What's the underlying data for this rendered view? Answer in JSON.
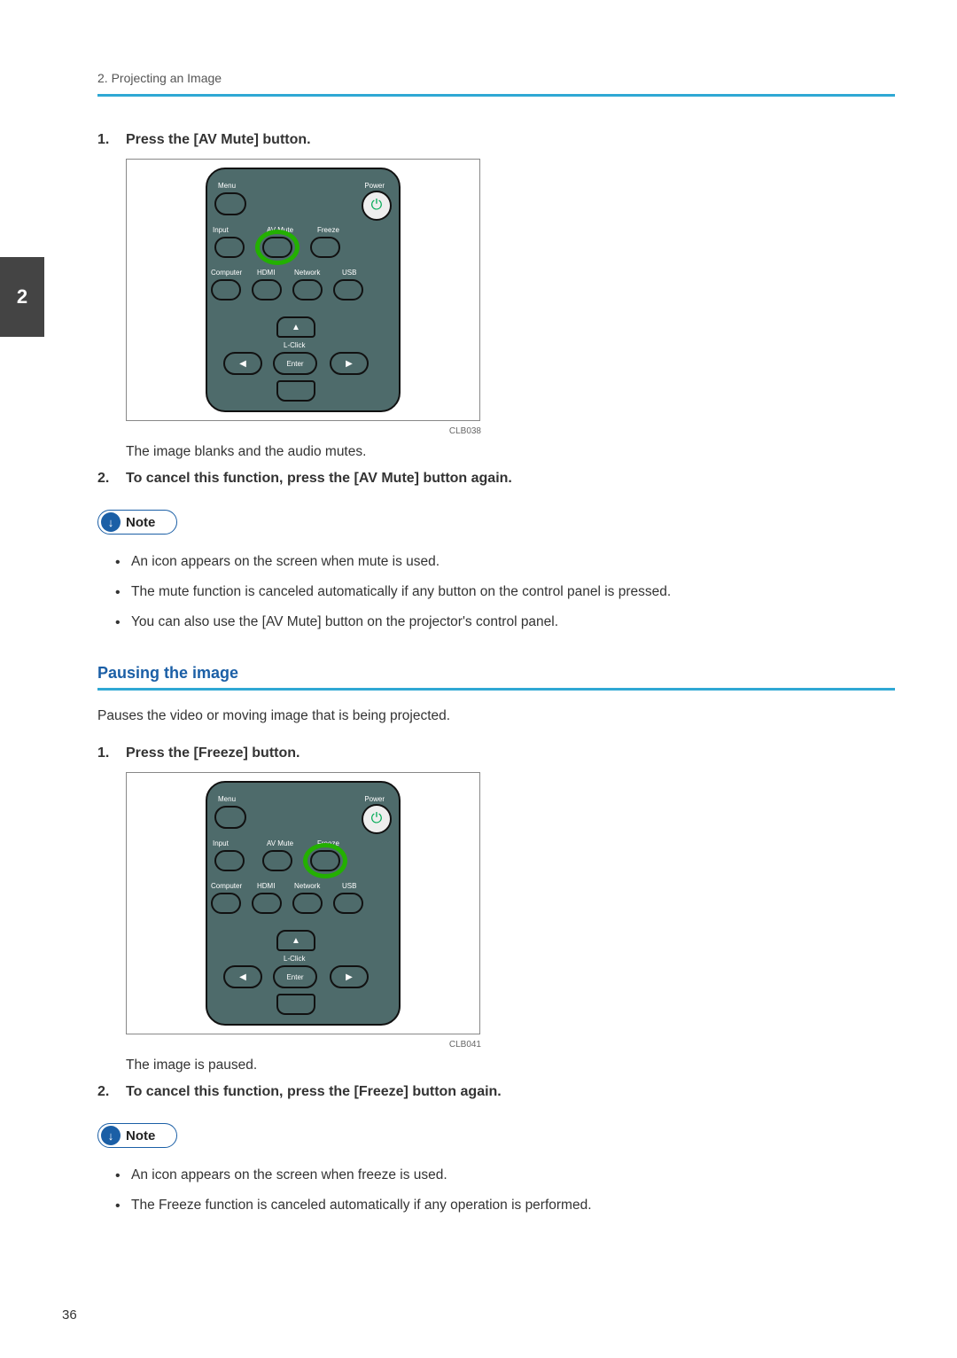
{
  "header": {
    "breadcrumb": "2. Projecting an Image"
  },
  "chapter_tab": "2",
  "section1": {
    "step1": {
      "num": "1.",
      "text": "Press the [AV Mute] button."
    },
    "remote": {
      "menu": "Menu",
      "power": "Power",
      "input": "Input",
      "avmute": "AV Mute",
      "freeze": "Freeze",
      "computer": "Computer",
      "hdmi": "HDMI",
      "network": "Network",
      "usb": "USB",
      "lclick": "L-Click",
      "enter": "Enter",
      "code": "CLB038"
    },
    "after1": "The image blanks and the audio mutes.",
    "step2": {
      "num": "2.",
      "text": "To cancel this function, press the [AV Mute] button again."
    },
    "note_label": "Note",
    "notes": {
      "a": "An icon appears on the screen when mute is used.",
      "b": "The mute function is canceled automatically if any button on the control panel is pressed.",
      "c": "You can also use the [AV Mute] button on the projector's control panel."
    }
  },
  "section2": {
    "title": "Pausing the image",
    "intro": "Pauses the video or moving image that is being projected.",
    "step1": {
      "num": "1.",
      "text": "Press the [Freeze] button."
    },
    "remote": {
      "menu": "Menu",
      "power": "Power",
      "input": "Input",
      "avmute": "AV Mute",
      "freeze": "Freeze",
      "computer": "Computer",
      "hdmi": "HDMI",
      "network": "Network",
      "usb": "USB",
      "lclick": "L-Click",
      "enter": "Enter",
      "code": "CLB041"
    },
    "after1": "The image is paused.",
    "step2": {
      "num": "2.",
      "text": "To cancel this function, press the [Freeze] button again."
    },
    "note_label": "Note",
    "notes": {
      "a": "An icon appears on the screen when freeze is used.",
      "b": "The Freeze function is canceled automatically if any operation is performed."
    }
  },
  "page_number": "36"
}
